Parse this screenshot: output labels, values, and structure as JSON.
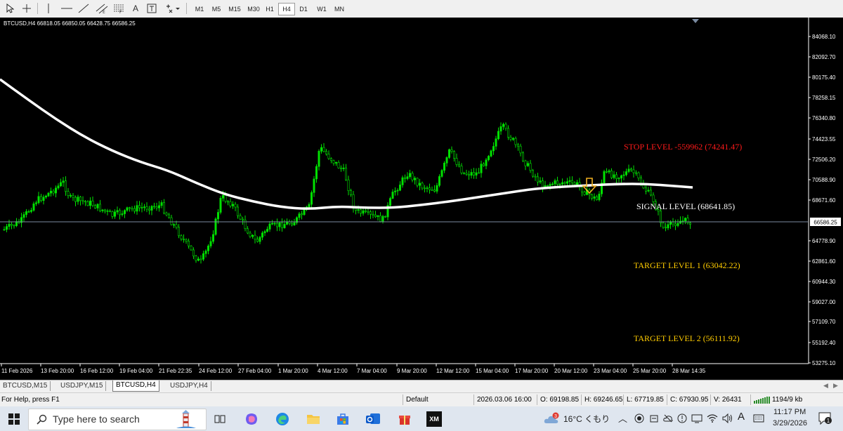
{
  "toolbar": {
    "timeframes": [
      "M1",
      "M5",
      "M15",
      "M30",
      "H1",
      "H4",
      "D1",
      "W1",
      "MN"
    ],
    "active_timeframe": "H4",
    "tools": [
      "cursor-icon",
      "crosshair-icon",
      "vertical-line-icon",
      "horizontal-line-icon",
      "trendline-icon",
      "channel-icon",
      "fibonacci-icon",
      "text-icon",
      "text-label-icon",
      "shapes-menu-icon"
    ],
    "text_tool_label": "A"
  },
  "chart": {
    "info": "BTCUSD,H4  66818.05 66850.05 66428.75 66586.25",
    "current_price": "66586.25",
    "price_labels": [
      "84068.10",
      "82092.70",
      "80175.40",
      "78258.15",
      "76340.80",
      "74423.55",
      "72506.20",
      "70588.90",
      "68671.60",
      "66586.25",
      "64778.90",
      "62861.60",
      "60944.30",
      "59027.00",
      "57109.70",
      "55192.40",
      "53275.10"
    ],
    "time_labels": [
      "11 Feb 2026",
      "13 Feb 20:00",
      "16 Feb 12:00",
      "19 Feb 04:00",
      "21 Feb 22:35",
      "24 Feb 12:00",
      "27 Feb 04:00",
      "1 Mar 20:00",
      "4 Mar 12:00",
      "7 Mar 04:00",
      "9 Mar 20:00",
      "12 Mar 12:00",
      "15 Mar 04:00",
      "17 Mar 20:00",
      "20 Mar 12:00",
      "23 Mar 04:00",
      "25 Mar 20:00",
      "28 Mar 14:35"
    ],
    "annotations": {
      "stop": "STOP LEVEL -559962 (74241.47)",
      "signal": "SIGNAL LEVEL (68641.85)",
      "target1": "TARGET LEVEL 1 (63042.22)",
      "target2": "TARGET LEVEL 2 (56111.92)"
    },
    "colors": {
      "background": "#000000",
      "candles": "#00e000",
      "moving_average": "#ffffff",
      "stop_text": "#ff1a1a",
      "signal_text": "#ffffff",
      "target_text": "#ffcc00",
      "signal_arrow": "#f0b020"
    }
  },
  "tabs": {
    "items": [
      "BTCUSD,M15",
      "USDJPY,M15",
      "BTCUSD,H4",
      "USDJPY,H4"
    ],
    "active": "BTCUSD,H4"
  },
  "status": {
    "help": "For Help, press F1",
    "profile": "Default",
    "datetime": "2026.03.06 16:00",
    "open": "O: 69198.85",
    "high": "H: 69246.65",
    "low": "L: 67719.85",
    "close": "C: 67930.95",
    "volume": "V: 26431",
    "connection": "1194/9 kb"
  },
  "taskbar": {
    "search_placeholder": "Type here to search",
    "weather": "16°C くもり",
    "weather_badge": "3",
    "ime": "A",
    "time": "11:17 PM",
    "date": "3/29/2026",
    "notification_count": "1",
    "xm_label": "XM"
  }
}
